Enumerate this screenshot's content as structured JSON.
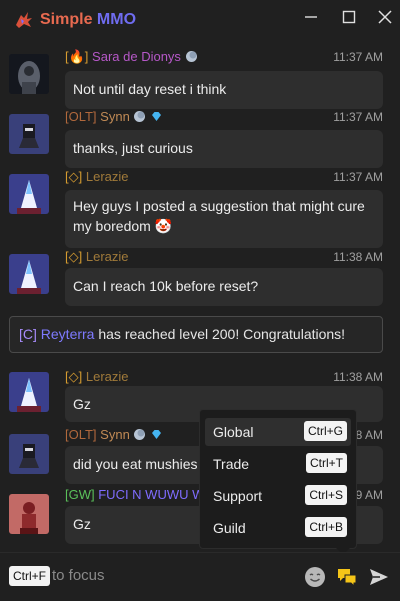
{
  "window": {
    "title_part1": "Simple",
    "title_part2": "MMO",
    "controls": [
      "minimize",
      "maximize",
      "close"
    ]
  },
  "messages": [
    {
      "tag": "[🔥]",
      "user": "Sara de Dionys",
      "badges": [
        "moon"
      ],
      "time": "11:37 AM",
      "text": "Not until day reset i think"
    },
    {
      "tag": "[OLT]",
      "user": "Synn",
      "badges": [
        "moon",
        "diamond"
      ],
      "time": "11:37 AM",
      "text": "thanks, just curious"
    },
    {
      "tag": "[◇]",
      "user": "Lerazie",
      "badges": [],
      "time": "11:37 AM",
      "text": "Hey guys I posted a suggestion that might cure my boredom 🤡"
    },
    {
      "tag": "[◇]",
      "user": "Lerazie",
      "badges": [],
      "time": "11:38 AM",
      "text": "Can I reach 10k before reset?"
    },
    {
      "tag": "[◇]",
      "user": "Lerazie",
      "badges": [],
      "time": "11:38 AM",
      "text": "Gz"
    },
    {
      "tag": "[OLT]",
      "user": "Synn",
      "badges": [
        "moon",
        "diamond"
      ],
      "time": "1:38 AM",
      "text": "did you eat mushies"
    },
    {
      "tag": "[GW]",
      "user": "FUCI N WUWU W",
      "badges": [],
      "time": "1:39 AM",
      "text": "Gz"
    }
  ],
  "system_message": {
    "tag": "[C]",
    "user": "Reyterra",
    "text": " has reached level 200! Congratulations!"
  },
  "channel_menu": {
    "items": [
      {
        "label": "Global",
        "shortcut": "Ctrl+G",
        "selected": true
      },
      {
        "label": "Trade",
        "shortcut": "Ctrl+T",
        "selected": false
      },
      {
        "label": "Support",
        "shortcut": "Ctrl+S",
        "selected": false
      },
      {
        "label": "Guild",
        "shortcut": "Ctrl+B",
        "selected": false
      }
    ]
  },
  "input": {
    "shortcut": "Ctrl+F",
    "placeholder": "to focus"
  },
  "icons": {
    "emoji": "smiley-icon",
    "channels": "chat-bubbles-icon",
    "send": "send-icon"
  },
  "colors": {
    "background": "#202020",
    "bubble": "#2e2e2e",
    "accent_orange": "#e86a50",
    "accent_purple": "#6f6cf0",
    "menu_bg": "#1c1c1c",
    "channel_icon": "#f5c518"
  }
}
